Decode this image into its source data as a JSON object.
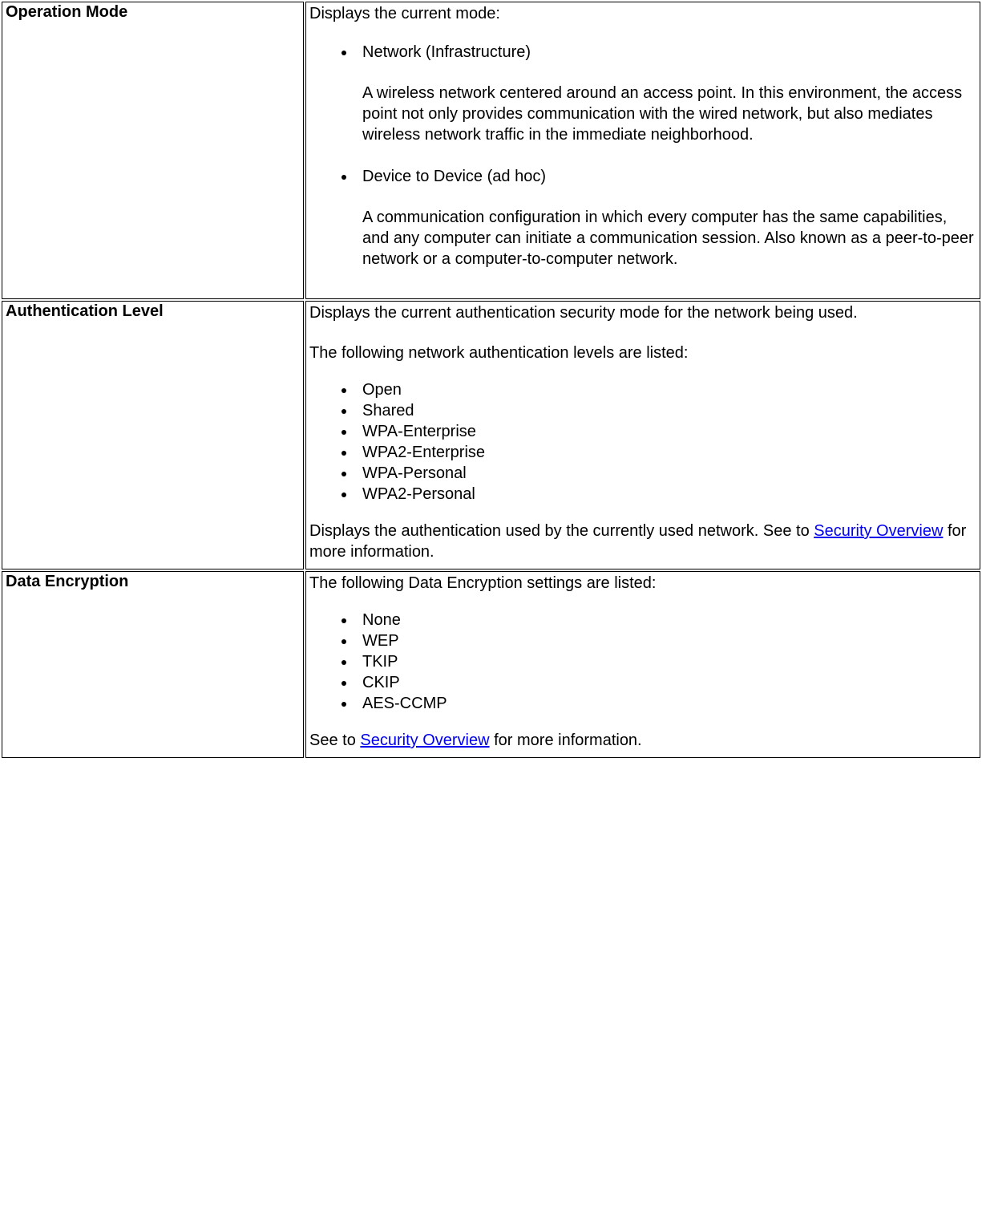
{
  "rows": {
    "op_mode": {
      "label": "Operation Mode",
      "intro": "Displays the current mode:",
      "items": [
        {
          "title": "Network (Infrastructure)",
          "desc": "A wireless network centered around an access point. In this environment, the access point not only provides communication with the wired network, but also mediates wireless network traffic in the immediate neighborhood."
        },
        {
          "title": "Device to Device (ad hoc)",
          "desc": "A communication configuration in which every computer has the same capabilities, and any computer can initiate a communication session. Also known as a peer-to-peer network or a computer-to-computer network."
        }
      ]
    },
    "auth_level": {
      "label": "Authentication Level",
      "para1": "Displays the current authentication security mode for the network being used.",
      "para2": "The following network authentication levels are listed:",
      "items": [
        "Open",
        "Shared",
        "WPA-Enterprise",
        "WPA2-Enterprise",
        "WPA-Personal",
        "WPA2-Personal"
      ],
      "para3_prefix": "Displays the authentication used by the currently used network. See to ",
      "link_text": "Security Overview",
      "para3_suffix": " for more information."
    },
    "data_enc": {
      "label": "Data Encryption",
      "para1": "The following Data Encryption settings are listed:",
      "items": [
        "None",
        "WEP",
        "TKIP",
        "CKIP",
        "AES-CCMP"
      ],
      "para2_prefix": "See to ",
      "link_text": "Security Overview",
      "para2_suffix": " for more information."
    }
  }
}
